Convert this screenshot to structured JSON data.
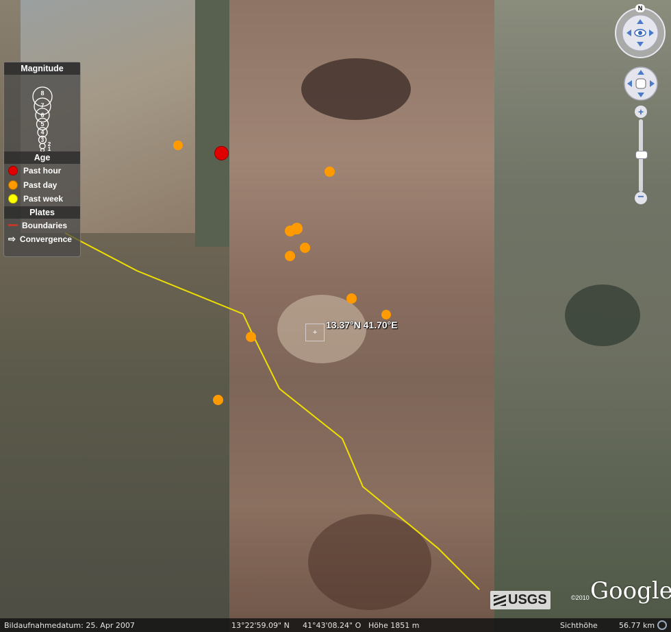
{
  "legend": {
    "magnitude_title": "Magnitude",
    "magnitude_levels": [
      "8",
      "7",
      "6",
      "5",
      "4",
      "3",
      "2",
      "1"
    ],
    "age_title": "Age",
    "age_items": [
      {
        "label": "Past hour",
        "color": "#e00000"
      },
      {
        "label": "Past day",
        "color": "#ff9a00"
      },
      {
        "label": "Past week",
        "color": "#ffff00"
      }
    ],
    "plates_title": "Plates",
    "plates_items": [
      {
        "label": "Boundaries",
        "color": "#c0392b"
      },
      {
        "label": "Convergence"
      }
    ]
  },
  "earthquakes": [
    {
      "age": "Past hour",
      "color": "#e00000"
    },
    {
      "age": "Past day",
      "color": "#ff9a00"
    }
  ],
  "overlay": {
    "center_coord": "13.37°N 41.70°E",
    "boundary_color": "#f0e000"
  },
  "branding": {
    "usgs": "USGS",
    "google": "Google",
    "copyright": "©2010"
  },
  "navigation": {
    "north": "N"
  },
  "status": {
    "imagery_date": "Bildaufnahmedatum: 25. Apr 2007",
    "lat": "13°22'59.09\" N",
    "lon": "41°43'08.24\" O",
    "elevation": "Höhe 1851 m",
    "eye_alt_label": "Sichthöhe",
    "eye_alt": "56.77 km"
  }
}
